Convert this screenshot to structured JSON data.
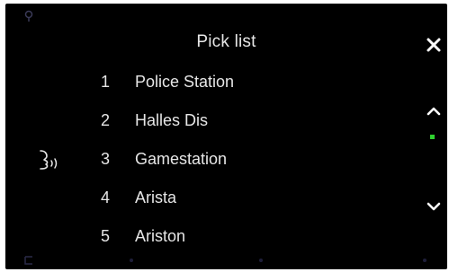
{
  "header": {
    "title": "Pick list"
  },
  "items": [
    {
      "number": "1",
      "label": "Police Station"
    },
    {
      "number": "2",
      "label": "Halles Dis"
    },
    {
      "number": "3",
      "label": "Gamestation"
    },
    {
      "number": "4",
      "label": "Arista"
    },
    {
      "number": "5",
      "label": "Ariston"
    }
  ],
  "icons": {
    "close": "close-icon",
    "scroll_up": "chevron-up-icon",
    "scroll_down": "chevron-down-icon",
    "voice": "voice-prompt-icon",
    "gps": "gps-icon",
    "back": "back-icon"
  },
  "scroll": {
    "position_fraction": 0.0
  },
  "colors": {
    "background": "#000000",
    "text": "#e6e6e6",
    "scroll_indicator": "#2fd12f"
  }
}
